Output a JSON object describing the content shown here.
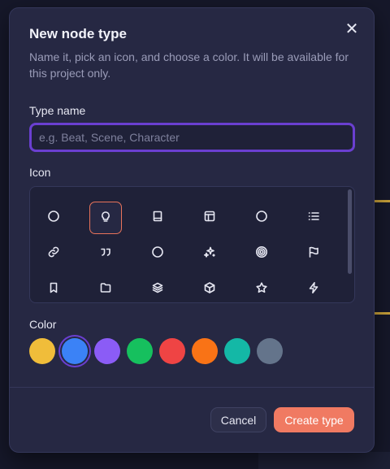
{
  "dialog": {
    "title": "New node type",
    "subtitle": "Name it, pick an icon, and choose a color. It will be available for this project only.",
    "close_icon": "close-icon"
  },
  "type_name": {
    "label": "Type name",
    "value": "",
    "placeholder": "e.g. Beat, Scene, Character"
  },
  "icon_picker": {
    "label": "Icon",
    "selected_index": 1,
    "icons": [
      "circle",
      "lightbulb",
      "book",
      "layout",
      "circle",
      "list",
      "link",
      "quote",
      "circle",
      "sparkles",
      "target",
      "flag",
      "bookmark",
      "folder",
      "layers",
      "cube",
      "star",
      "zap"
    ]
  },
  "color_picker": {
    "label": "Color",
    "selected_index": 1,
    "colors": [
      "#f0bd3a",
      "#3b82f6",
      "#8b5cf6",
      "#16c05e",
      "#ef4444",
      "#f97316",
      "#14b8a6",
      "#64748b"
    ]
  },
  "footer": {
    "cancel_label": "Cancel",
    "create_label": "Create type"
  }
}
